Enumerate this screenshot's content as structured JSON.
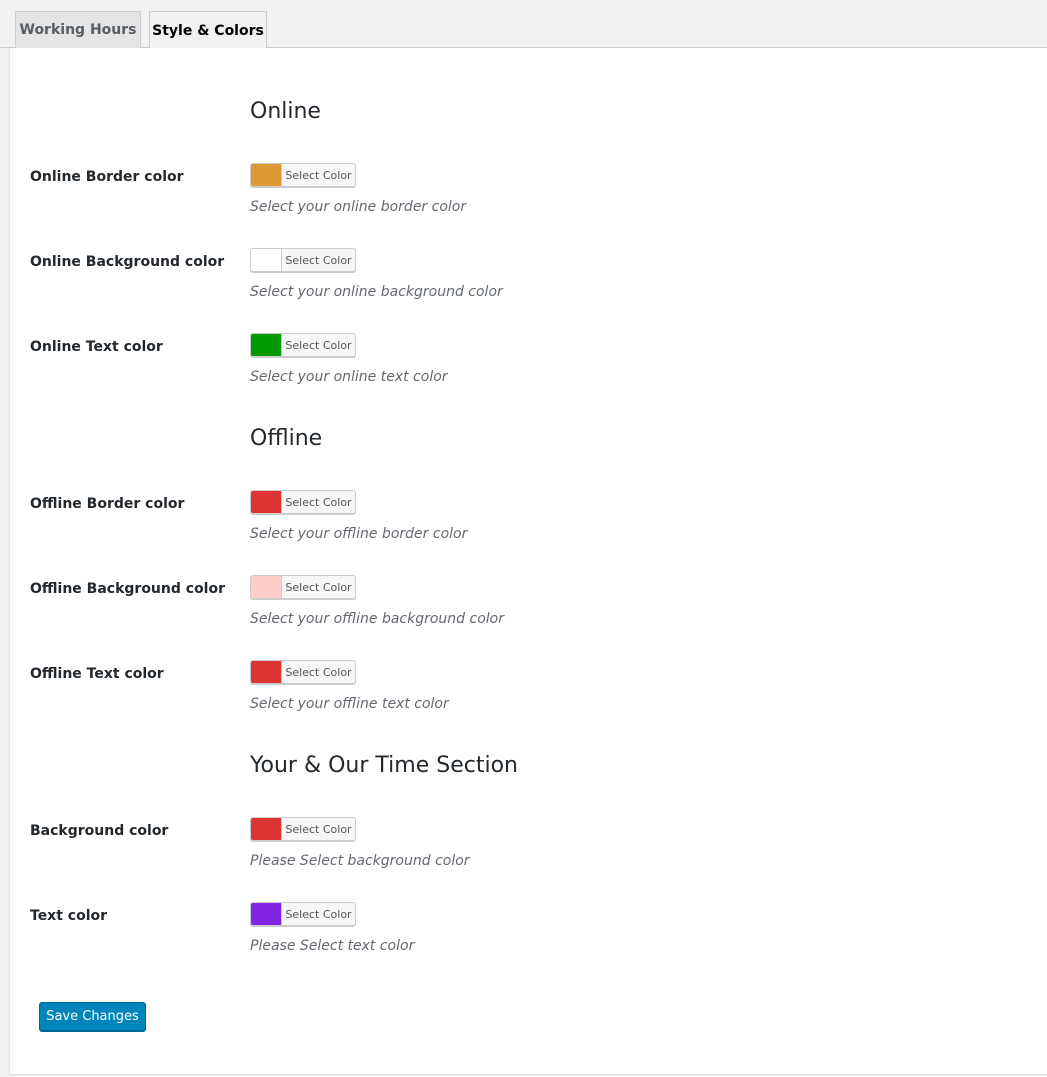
{
  "tabs": [
    {
      "label": "Working Hours"
    },
    {
      "label": "Style & Colors"
    }
  ],
  "picker_label": "Select Color",
  "sections": [
    {
      "title": "Online",
      "rows": [
        {
          "label": "Online Border color",
          "desc": "Select your online border color",
          "color": "#dd9933"
        },
        {
          "label": "Online Background color",
          "desc": "Select your online background color",
          "color": "#ffffff"
        },
        {
          "label": "Online Text color",
          "desc": "Select your online text color",
          "color": "#009900"
        }
      ]
    },
    {
      "title": "Offline",
      "rows": [
        {
          "label": "Offline Border color",
          "desc": "Select your offline border color",
          "color": "#dd3333"
        },
        {
          "label": "Offline Background color",
          "desc": "Select your offline background color",
          "color": "#ffcccc"
        },
        {
          "label": "Offline Text color",
          "desc": "Select your offline text color",
          "color": "#dd3333"
        }
      ]
    },
    {
      "title": "Your & Our Time Section",
      "rows": [
        {
          "label": "Background color",
          "desc": "Please Select background color",
          "color": "#dd3333"
        },
        {
          "label": "Text color",
          "desc": "Please Select text color",
          "color": "#8224e3"
        }
      ]
    }
  ],
  "save_label": "Save Changes"
}
